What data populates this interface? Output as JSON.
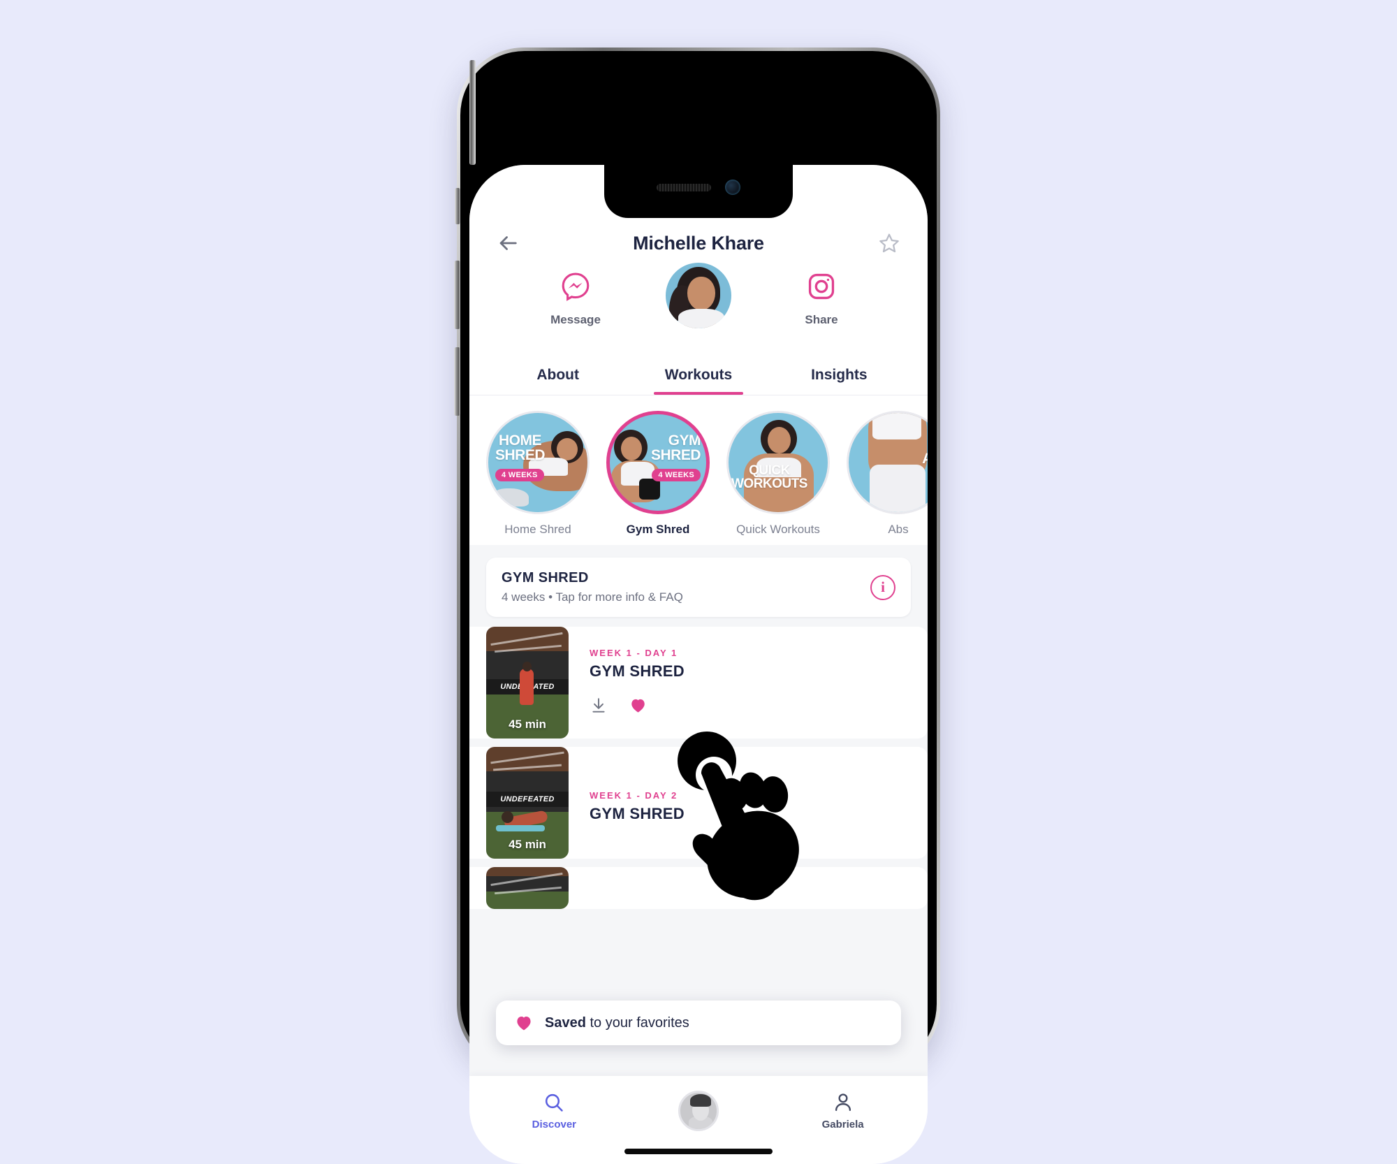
{
  "background_color": "#e8eafb",
  "accent_pink": "#e0408f",
  "accent_blue": "#5a5fe0",
  "header": {
    "title": "Michelle Khare",
    "back_icon": "arrow-left-icon",
    "star_icon": "star-outline-icon"
  },
  "profile_actions": {
    "message": {
      "label": "Message",
      "icon": "messenger-icon"
    },
    "share": {
      "label": "Share",
      "icon": "instagram-icon"
    },
    "avatar": "profile-avatar"
  },
  "tabs": [
    {
      "label": "About",
      "active": false
    },
    {
      "label": "Workouts",
      "active": true
    },
    {
      "label": "Insights",
      "active": false
    }
  ],
  "programs": [
    {
      "label": "Home Shred",
      "circle_line1": "HOME",
      "circle_line2": "SHRED",
      "badge": "4 WEEKS",
      "selected": false
    },
    {
      "label": "Gym Shred",
      "circle_line1": "GYM",
      "circle_line2": "SHRED",
      "badge": "4 WEEKS",
      "selected": true
    },
    {
      "label": "Quick Workouts",
      "circle_line1": "QUICK",
      "circle_line2": "WORKOUTS",
      "badge": "",
      "selected": false
    },
    {
      "label": "Abs",
      "circle_line1": "ABS",
      "circle_line2": "",
      "badge": "",
      "selected": false
    }
  ],
  "program_info": {
    "title": "GYM SHRED",
    "subtitle": "4 weeks  •  Tap for more info & FAQ",
    "info_icon": "info-circle-icon",
    "info_glyph": "i"
  },
  "workouts": [
    {
      "week": "WEEK 1 - DAY 1",
      "title": "GYM SHRED",
      "duration": "45 min",
      "thumb_banner": "UNDEFEATED",
      "download_icon": "download-icon",
      "favorite_icon": "heart-filled-icon",
      "favorited": true
    },
    {
      "week": "WEEK 1 - DAY 2",
      "title": "GYM SHRED",
      "duration": "45 min",
      "thumb_banner": "UNDEFEATED",
      "download_icon": "download-icon",
      "favorite_icon": "heart-filled-icon",
      "favorited": true
    },
    {
      "week": "",
      "title": "",
      "duration": "",
      "thumb_banner": "",
      "download_icon": "",
      "favorite_icon": "",
      "favorited": false
    }
  ],
  "toast": {
    "icon": "heart-filled-icon",
    "bold_text": "Saved",
    "rest_text": " to your favorites"
  },
  "bottom_nav": [
    {
      "label": "Discover",
      "icon": "search-icon",
      "active": true
    },
    {
      "label": "",
      "icon": "center-avatar",
      "active": false
    },
    {
      "label": "Gabriela",
      "icon": "person-icon",
      "active": false
    }
  ],
  "cursor": {
    "icon": "hand-pointer-cursor"
  }
}
